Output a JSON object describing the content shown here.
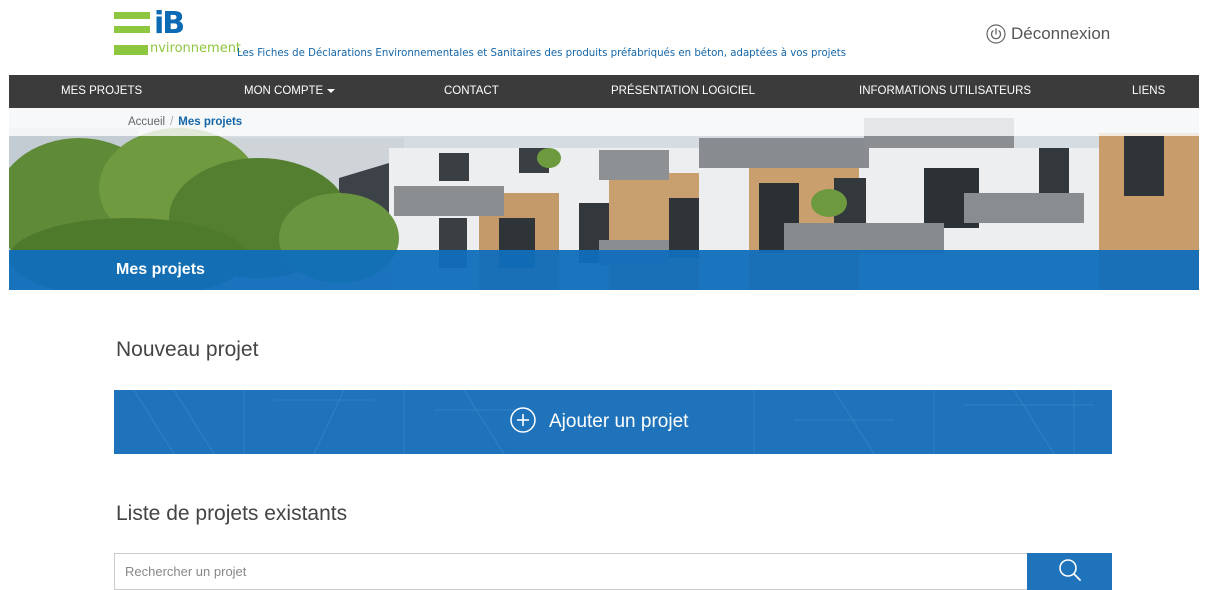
{
  "header": {
    "logo": {
      "mark": "iB",
      "subtitle": "nvironnement"
    },
    "tagline": "Les Fiches de Déclarations Environnementales et Sanitaires des produits préfabriqués en béton, adaptées à vos projets",
    "logout_label": "Déconnexion",
    "logout_icon": "power-icon"
  },
  "nav": {
    "items": [
      {
        "label": "MES PROJETS"
      },
      {
        "label": "MON COMPTE",
        "dropdown": true
      },
      {
        "label": "CONTACT"
      },
      {
        "label": "PRÉSENTATION LOGICIEL"
      },
      {
        "label": "INFORMATIONS UTILISATEURS"
      },
      {
        "label": "LIENS"
      }
    ]
  },
  "breadcrumb": {
    "home": "Accueil",
    "separator": "/",
    "current": "Mes projets"
  },
  "banner": {
    "title": "Mes projets"
  },
  "new_project": {
    "title": "Nouveau projet",
    "add_label": "Ajouter un projet",
    "add_icon": "plus-circle-icon"
  },
  "existing": {
    "title": "Liste de projets existants",
    "search_placeholder": "Rechercher un projet",
    "search_icon": "search-icon"
  },
  "colors": {
    "brand_blue": "#1f73ba",
    "brand_green": "#8dc63f",
    "nav_bg": "#3b3b3b"
  }
}
